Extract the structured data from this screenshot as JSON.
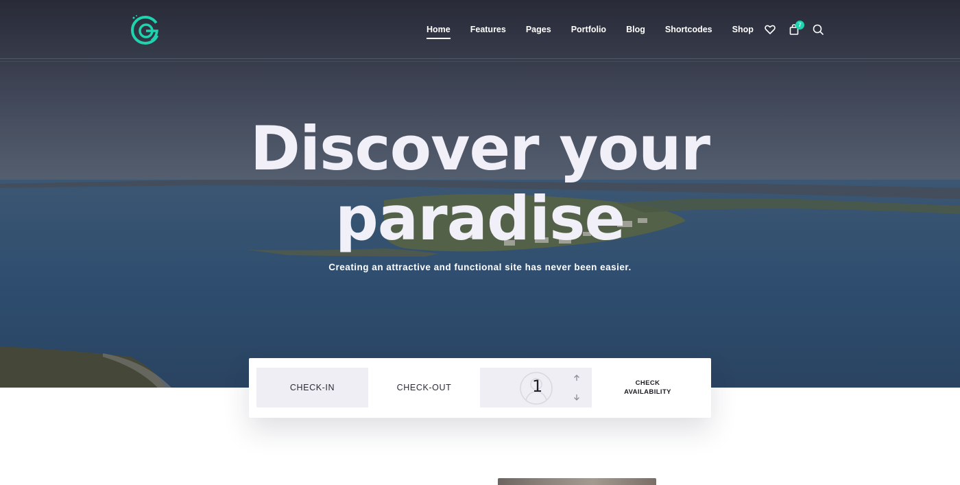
{
  "header": {
    "logo_icon": "stylized-g-circuit-logo",
    "accent_color": "#1fd3ae",
    "nav": [
      {
        "label": "Home",
        "active": true
      },
      {
        "label": "Features",
        "active": false
      },
      {
        "label": "Pages",
        "active": false
      },
      {
        "label": "Portfolio",
        "active": false
      },
      {
        "label": "Blog",
        "active": false
      },
      {
        "label": "Shortcodes",
        "active": false
      },
      {
        "label": "Shop",
        "active": false
      }
    ],
    "icons": [
      "heart-icon",
      "shopping-bag-icon",
      "search-icon"
    ],
    "cart_count": "7"
  },
  "hero": {
    "title_line1": "Discover your",
    "title_line2": "paradise",
    "subtitle": "Creating an attractive and functional site has never been easier."
  },
  "booking": {
    "check_in": "CHECK-IN",
    "check_out": "CHECK-OUT",
    "guests_value": "1",
    "check_button": "CHECK\nAVAILABILITY"
  }
}
